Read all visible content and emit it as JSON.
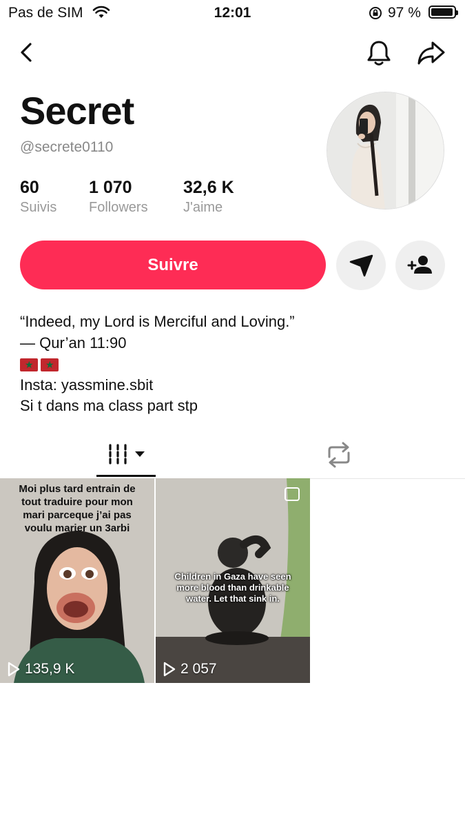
{
  "status_bar": {
    "carrier": "Pas de SIM",
    "time": "12:01",
    "battery_percent": "97 %",
    "battery_level": 0.97
  },
  "profile": {
    "display_name": "Secret",
    "username": "@secrete0110",
    "stats": [
      {
        "value": "60",
        "label": "Suivis"
      },
      {
        "value": "1 070",
        "label": "Followers"
      },
      {
        "value": "32,6 K",
        "label": "J'aime"
      }
    ],
    "follow_label": "Suivre",
    "bio_lines": [
      "“Indeed, my Lord is Merciful and Loving.”",
      "— Qur’an 11:90",
      "Insta: yassmine.sbit",
      "Si t dans ma class part stp"
    ]
  },
  "videos": [
    {
      "caption": "Moi plus tard entrain de tout traduire pour mon mari parceque j’ai pas voulu marier un 3arbi",
      "views": "135,9 K"
    },
    {
      "caption": "Children in Gaza have seen more blood than drinkable water. Let that sink in.",
      "views": "2 057"
    }
  ],
  "colors": {
    "accent": "#fe2c55",
    "secondary_button": "#efefef",
    "muted_text": "#888888"
  },
  "icons": [
    "back-icon",
    "bell-icon",
    "share-icon",
    "send-icon",
    "add-friend-icon",
    "grid-icon",
    "repost-icon",
    "play-icon"
  ]
}
